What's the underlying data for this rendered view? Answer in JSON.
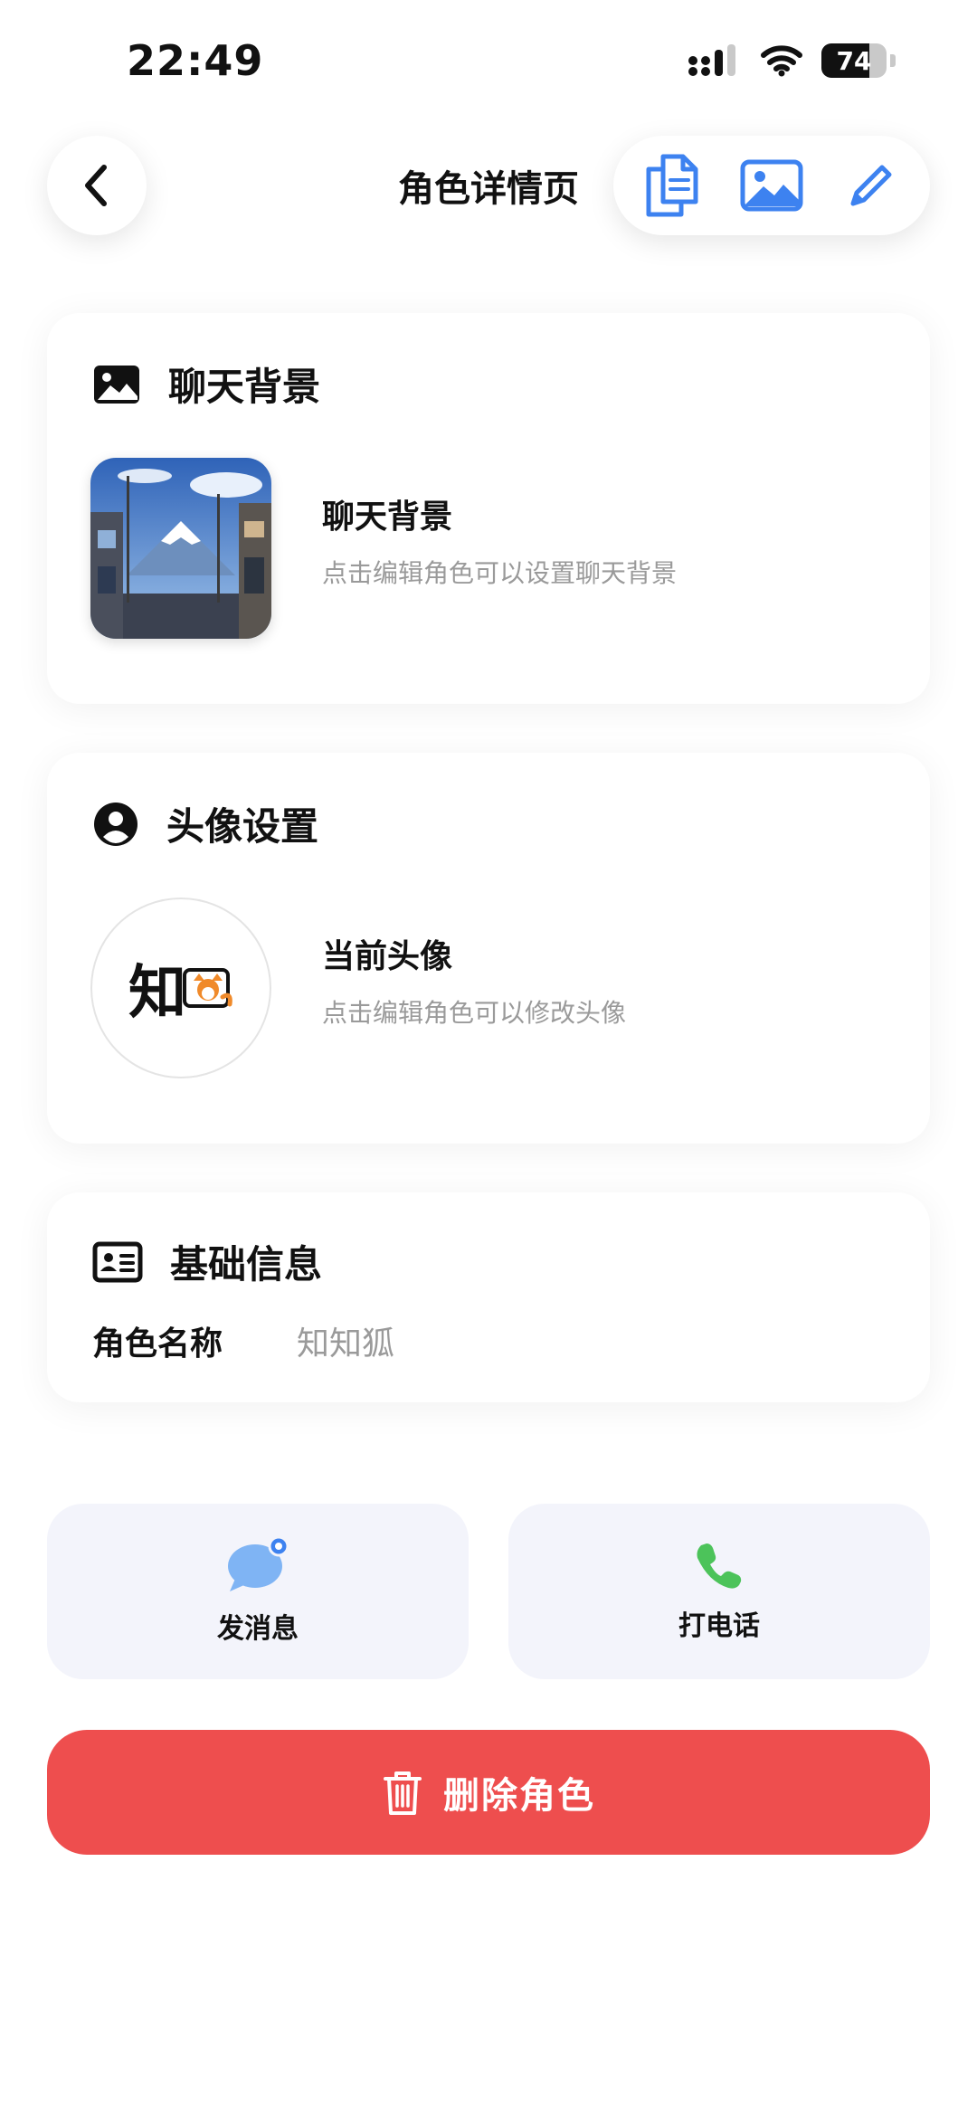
{
  "status_bar": {
    "time": "22:49",
    "battery": "74",
    "battery_level": 0.74
  },
  "header": {
    "title": "角色详情页",
    "icons": [
      "back-icon",
      "copy-icon",
      "image-icon",
      "edit-icon"
    ]
  },
  "chat_background": {
    "section_title": "聊天背景",
    "item_title": "聊天背景",
    "item_subtitle": "点击编辑角色可以设置聊天背景"
  },
  "avatar_settings": {
    "section_title": "头像设置",
    "item_title": "当前头像",
    "item_subtitle": "点击编辑角色可以修改头像",
    "avatar_text": "知"
  },
  "basic_info": {
    "section_title": "基础信息",
    "name_label": "角色名称",
    "name_value": "知知狐"
  },
  "actions": {
    "message_label": "发消息",
    "call_label": "打电话",
    "delete_label": "删除角色"
  },
  "colors": {
    "accent_blue": "#3d82f0",
    "delete_red": "#ee4e4e",
    "call_green": "#4cc35a",
    "message_blue": "#7fb4f4"
  }
}
